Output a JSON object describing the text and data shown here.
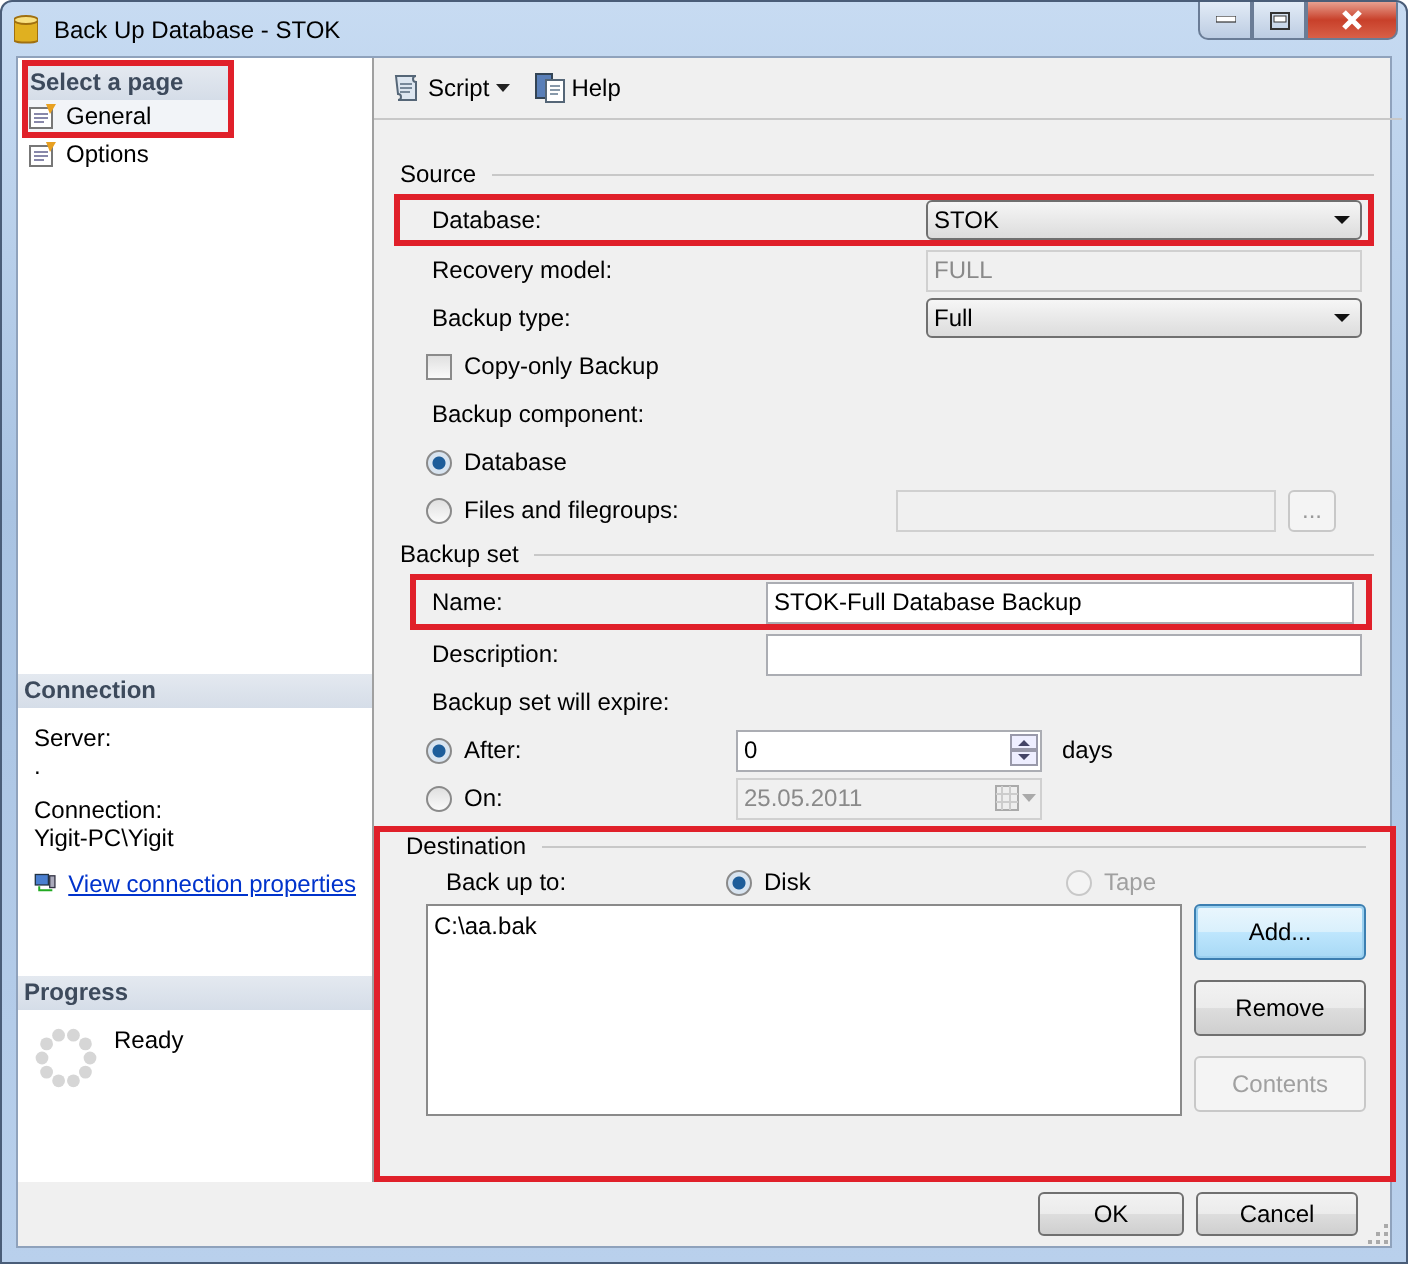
{
  "window": {
    "title": "Back Up Database - STOK"
  },
  "sidebar": {
    "header": "Select a page",
    "highlighted": true,
    "pages": [
      {
        "label": "General",
        "selected": true
      },
      {
        "label": "Options",
        "selected": false
      }
    ],
    "connection": {
      "header": "Connection",
      "server_label": "Server:",
      "server_value": ".",
      "connection_label": "Connection:",
      "connection_value": "Yigit-PC\\Yigit",
      "link": "View connection properties"
    },
    "progress": {
      "header": "Progress",
      "status": "Ready"
    }
  },
  "toolbar": [
    {
      "label": "Script",
      "kind": "dropdown"
    },
    {
      "label": "Help",
      "kind": "button"
    }
  ],
  "source": {
    "title": "Source",
    "database": {
      "label": "Database:",
      "value": "STOK",
      "highlighted": true
    },
    "recovery_model": {
      "label": "Recovery model:",
      "value": "FULL",
      "disabled": true
    },
    "backup_type": {
      "label": "Backup type:",
      "value": "Full"
    },
    "copy_only": {
      "label": "Copy-only Backup",
      "checked": false
    },
    "component_label": "Backup component:",
    "components": [
      {
        "label": "Database",
        "selected": true
      },
      {
        "label": "Files and filegroups:",
        "selected": false
      }
    ],
    "browse": "..."
  },
  "backup_set": {
    "title": "Backup set",
    "name": {
      "label": "Name:",
      "value": "STOK-Full Database Backup",
      "highlighted": true
    },
    "description": {
      "label": "Description:"
    },
    "expire_label": "Backup set will expire:",
    "expire_options": [
      {
        "label": "After:",
        "selected": true,
        "kind": "spin",
        "value": "0",
        "unit": "days"
      },
      {
        "label": "On:",
        "selected": false,
        "kind": "date",
        "value": "25.05.2011"
      }
    ]
  },
  "destination": {
    "title": "Destination",
    "highlighted": true,
    "backup_to_label": "Back up to:",
    "media": [
      {
        "label": "Disk",
        "selected": true,
        "disabled": false
      },
      {
        "label": "Tape",
        "selected": false,
        "disabled": true
      }
    ],
    "files": [
      "C:\\aa.bak"
    ],
    "buttons": [
      {
        "label": "Add...",
        "default": true,
        "disabled": false
      },
      {
        "label": "Remove",
        "default": false,
        "disabled": false
      },
      {
        "label": "Contents",
        "default": false,
        "disabled": true
      }
    ]
  },
  "footer": {
    "buttons": [
      "OK",
      "Cancel"
    ]
  }
}
